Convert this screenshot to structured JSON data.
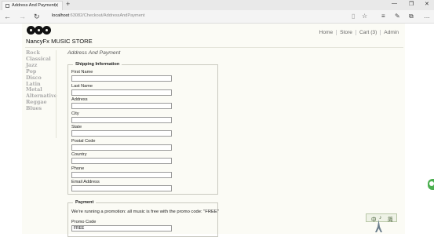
{
  "browser": {
    "tab_title": "Address And Payment",
    "tab_close": "✕",
    "new_tab": "+",
    "window_controls": [
      "—",
      "❐",
      "✕"
    ],
    "address_host": "localhost",
    "address_path": ":63082/Checkout/AddressAndPayment",
    "nav": {
      "back": "←",
      "forward": "→",
      "refresh": "↻"
    },
    "tools": {
      "reading_view": "▯",
      "favorite": "☆",
      "hub": "≡",
      "notes": "✎",
      "share": "⧉",
      "more": "…"
    }
  },
  "site": {
    "brand": "NancyFx MUSIC STORE",
    "nav": [
      "Home",
      "Store",
      "Cart (3)",
      "Admin"
    ],
    "genres": [
      "Rock",
      "Classical",
      "Jazz",
      "Pop",
      "Disco",
      "Latin",
      "Metal",
      "Alternative",
      "Reggae",
      "Blues"
    ]
  },
  "checkout": {
    "page_title": "Address And Payment",
    "shipping_legend": "Shipping Information",
    "fields": [
      {
        "label": "First Name",
        "value": ""
      },
      {
        "label": "Last Name",
        "value": ""
      },
      {
        "label": "Address",
        "value": ""
      },
      {
        "label": "City",
        "value": ""
      },
      {
        "label": "State",
        "value": ""
      },
      {
        "label": "Postal Code",
        "value": ""
      },
      {
        "label": "Country",
        "value": ""
      },
      {
        "label": "Phone",
        "value": ""
      },
      {
        "label": "Email Address",
        "value": ""
      }
    ],
    "payment_legend": "Payment",
    "promo_message": "We're running a promotion: all music is free with the promo code: \"FREE\"",
    "promo_label": "Promo Code",
    "promo_value": "FREE"
  },
  "ime": {
    "chars": [
      "中",
      "♪",
      "简"
    ]
  }
}
